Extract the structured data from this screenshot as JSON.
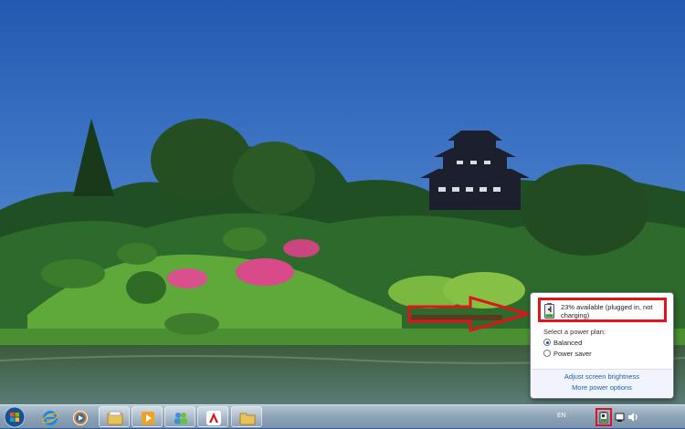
{
  "screen": {
    "title": "Windows 7 desktop with battery status flyout"
  },
  "battery_flyout": {
    "status_text": "23% available (plugged in, not charging)",
    "battery_level_percent": 23,
    "plan_heading": "Select a power plan:",
    "plans": [
      {
        "label": "Balanced",
        "selected": true
      },
      {
        "label": "Power saver",
        "selected": false
      }
    ],
    "links": {
      "brightness": "Adjust screen brightness",
      "more_options": "More power options"
    }
  },
  "taskbar": {
    "pinned": [
      {
        "name": "internet-explorer-icon"
      },
      {
        "name": "windows-media-player-icon"
      },
      {
        "name": "windows-explorer-icon"
      },
      {
        "name": "media-center-icon"
      },
      {
        "name": "users-icon"
      },
      {
        "name": "avira-icon"
      },
      {
        "name": "folder-icon"
      }
    ],
    "tray": {
      "language": "EN",
      "icons": [
        "battery-icon",
        "action-center-icon",
        "volume-icon"
      ]
    }
  },
  "colors": {
    "annotation_red": "#e0141b",
    "annotation_yellow": "#f4ef22",
    "link_blue": "#1a5fb4"
  }
}
